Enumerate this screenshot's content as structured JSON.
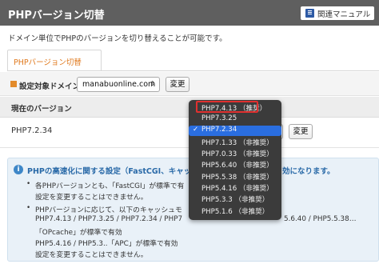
{
  "header": {
    "title": "PHPバージョン切替",
    "manual_label": "関連マニュアル"
  },
  "description": "ドメイン単位でPHPのバージョンを切り替えることが可能です。",
  "tab": {
    "label": "PHPバージョン切替"
  },
  "target": {
    "label": "設定対象ドメイン",
    "domain": "manabuonline.com",
    "change_label": "変更"
  },
  "current": {
    "header": "現在のバージョン",
    "value": "PHP7.2.34",
    "change_label": "変更"
  },
  "dropdown": {
    "options": [
      "PHP7.4.13 （推奨）",
      "PHP7.3.25",
      "PHP7.2.34",
      "PHP7.1.33 （非推奨）",
      "PHP7.0.33 （非推奨）",
      "PHP5.6.40 （非推奨）",
      "PHP5.5.38 （非推奨）",
      "PHP5.4.16 （非推奨）",
      "PHP5.3.3 （非推奨）",
      "PHP5.1.6 （非推奨）"
    ],
    "selected": "PHP7.2.34",
    "check": "✓"
  },
  "info": {
    "title": "PHPの高速化に関する設定（FastCGI、キャッ",
    "title_tail": "効になります。",
    "bullet": "•",
    "lines": [
      "各PHPバージョンとも、「FastCGI」が標準で有",
      "設定を変更することはできません。",
      "PHPバージョンに応じて、以下のキャッシュモ",
      "PHP7.4.13 / PHP7.3.25 / PHP7.2.34 / PHP7",
      "「OPcache」が標準で有効",
      "PHP5.4.16 / PHP5.3..「APC」が標準で有効",
      "設定を変更することはできません。"
    ],
    "line4_tail": "5.6.40 / PHP5.5.38…"
  },
  "colors": {
    "title_bar": "#5f5f5f",
    "tab_text": "#e07a1f",
    "dropdown_bg": "#3b3b3b",
    "selected_bg": "#2a6ee0",
    "highlight": "#e0302f",
    "info_title": "#2a6aa8"
  }
}
